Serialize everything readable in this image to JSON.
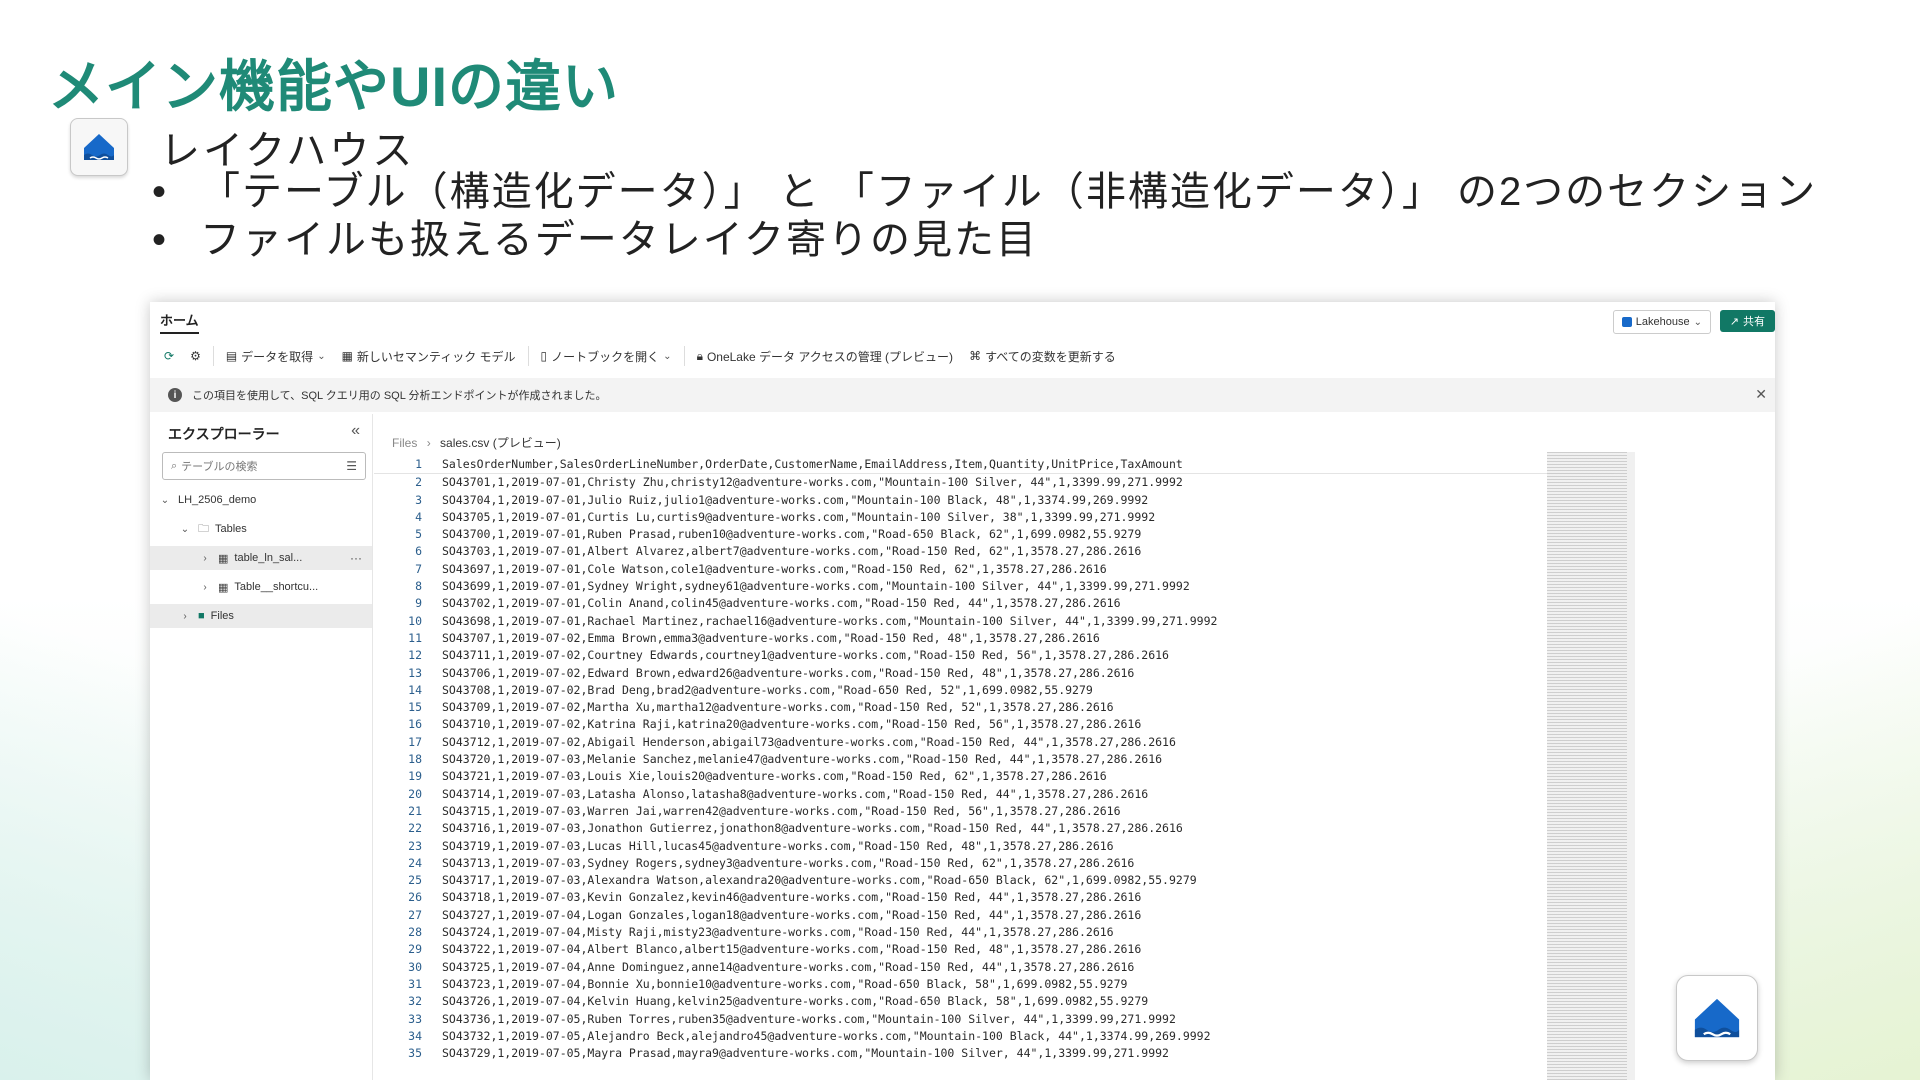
{
  "slide": {
    "title": "メイン機能やUIの違い",
    "section_heading": "レイクハウス",
    "bullets": [
      "「テーブル（構造化データ）」 と 「ファイル（非構造化データ）」 の2つのセクション",
      "ファイルも扱えるデータレイク寄りの見た目"
    ]
  },
  "app": {
    "tab_home": "ホーム",
    "workspace_pill": "Lakehouse",
    "share_label": "共有",
    "toolbar": {
      "get_data": "データを取得",
      "new_semantic_model": "新しいセマンティック モデル",
      "open_notebook": "ノートブックを開く",
      "onelake_access": "OneLake データ アクセスの管理 (プレビュー)",
      "refresh_all": "すべての変数を更新する"
    },
    "infobar": "この項目を使用して、SQL クエリ用の SQL 分析エンドポイントが作成されました。",
    "explorer": {
      "title": "エクスプローラー",
      "search_placeholder": "テーブルの検索",
      "lakehouse_name": "LH_2506_demo",
      "tables_label": "Tables",
      "table_item_1": "table_ln_sal...",
      "table_item_2": "Table__shortcu...",
      "files_label": "Files"
    },
    "breadcrumb": {
      "root": "Files",
      "current": "sales.csv (プレビュー)"
    },
    "csv_lines": [
      "SalesOrderNumber,SalesOrderLineNumber,OrderDate,CustomerName,EmailAddress,Item,Quantity,UnitPrice,TaxAmount",
      "SO43701,1,2019-07-01,Christy Zhu,christy12@adventure-works.com,\"Mountain-100 Silver, 44\",1,3399.99,271.9992",
      "SO43704,1,2019-07-01,Julio Ruiz,julio1@adventure-works.com,\"Mountain-100 Black, 48\",1,3374.99,269.9992",
      "SO43705,1,2019-07-01,Curtis Lu,curtis9@adventure-works.com,\"Mountain-100 Silver, 38\",1,3399.99,271.9992",
      "SO43700,1,2019-07-01,Ruben Prasad,ruben10@adventure-works.com,\"Road-650 Black, 62\",1,699.0982,55.9279",
      "SO43703,1,2019-07-01,Albert Alvarez,albert7@adventure-works.com,\"Road-150 Red, 62\",1,3578.27,286.2616",
      "SO43697,1,2019-07-01,Cole Watson,cole1@adventure-works.com,\"Road-150 Red, 62\",1,3578.27,286.2616",
      "SO43699,1,2019-07-01,Sydney Wright,sydney61@adventure-works.com,\"Mountain-100 Silver, 44\",1,3399.99,271.9992",
      "SO43702,1,2019-07-01,Colin Anand,colin45@adventure-works.com,\"Road-150 Red, 44\",1,3578.27,286.2616",
      "SO43698,1,2019-07-01,Rachael Martinez,rachael16@adventure-works.com,\"Mountain-100 Silver, 44\",1,3399.99,271.9992",
      "SO43707,1,2019-07-02,Emma Brown,emma3@adventure-works.com,\"Road-150 Red, 48\",1,3578.27,286.2616",
      "SO43711,1,2019-07-02,Courtney Edwards,courtney1@adventure-works.com,\"Road-150 Red, 56\",1,3578.27,286.2616",
      "SO43706,1,2019-07-02,Edward Brown,edward26@adventure-works.com,\"Road-150 Red, 48\",1,3578.27,286.2616",
      "SO43708,1,2019-07-02,Brad Deng,brad2@adventure-works.com,\"Road-650 Red, 52\",1,699.0982,55.9279",
      "SO43709,1,2019-07-02,Martha Xu,martha12@adventure-works.com,\"Road-150 Red, 52\",1,3578.27,286.2616",
      "SO43710,1,2019-07-02,Katrina Raji,katrina20@adventure-works.com,\"Road-150 Red, 56\",1,3578.27,286.2616",
      "SO43712,1,2019-07-02,Abigail Henderson,abigail73@adventure-works.com,\"Road-150 Red, 44\",1,3578.27,286.2616",
      "SO43720,1,2019-07-03,Melanie Sanchez,melanie47@adventure-works.com,\"Road-150 Red, 44\",1,3578.27,286.2616",
      "SO43721,1,2019-07-03,Louis Xie,louis20@adventure-works.com,\"Road-150 Red, 62\",1,3578.27,286.2616",
      "SO43714,1,2019-07-03,Latasha Alonso,latasha8@adventure-works.com,\"Road-150 Red, 44\",1,3578.27,286.2616",
      "SO43715,1,2019-07-03,Warren Jai,warren42@adventure-works.com,\"Road-150 Red, 56\",1,3578.27,286.2616",
      "SO43716,1,2019-07-03,Jonathon Gutierrez,jonathon8@adventure-works.com,\"Road-150 Red, 44\",1,3578.27,286.2616",
      "SO43719,1,2019-07-03,Lucas Hill,lucas45@adventure-works.com,\"Road-150 Red, 48\",1,3578.27,286.2616",
      "SO43713,1,2019-07-03,Sydney Rogers,sydney3@adventure-works.com,\"Road-150 Red, 62\",1,3578.27,286.2616",
      "SO43717,1,2019-07-03,Alexandra Watson,alexandra20@adventure-works.com,\"Road-650 Black, 62\",1,699.0982,55.9279",
      "SO43718,1,2019-07-03,Kevin Gonzalez,kevin46@adventure-works.com,\"Road-150 Red, 44\",1,3578.27,286.2616",
      "SO43727,1,2019-07-04,Logan Gonzales,logan18@adventure-works.com,\"Road-150 Red, 44\",1,3578.27,286.2616",
      "SO43724,1,2019-07-04,Misty Raji,misty23@adventure-works.com,\"Road-150 Red, 44\",1,3578.27,286.2616",
      "SO43722,1,2019-07-04,Albert Blanco,albert15@adventure-works.com,\"Road-150 Red, 48\",1,3578.27,286.2616",
      "SO43725,1,2019-07-04,Anne Dominguez,anne14@adventure-works.com,\"Road-150 Red, 44\",1,3578.27,286.2616",
      "SO43723,1,2019-07-04,Bonnie Xu,bonnie10@adventure-works.com,\"Road-650 Black, 58\",1,699.0982,55.9279",
      "SO43726,1,2019-07-04,Kelvin Huang,kelvin25@adventure-works.com,\"Road-650 Black, 58\",1,699.0982,55.9279",
      "SO43736,1,2019-07-05,Ruben Torres,ruben35@adventure-works.com,\"Mountain-100 Silver, 44\",1,3399.99,271.9992",
      "SO43732,1,2019-07-05,Alejandro Beck,alejandro45@adventure-works.com,\"Mountain-100 Black, 44\",1,3374.99,269.9992",
      "SO43729,1,2019-07-05,Mayra Prasad,mayra9@adventure-works.com,\"Mountain-100 Silver, 44\",1,3399.99,271.9992"
    ]
  }
}
